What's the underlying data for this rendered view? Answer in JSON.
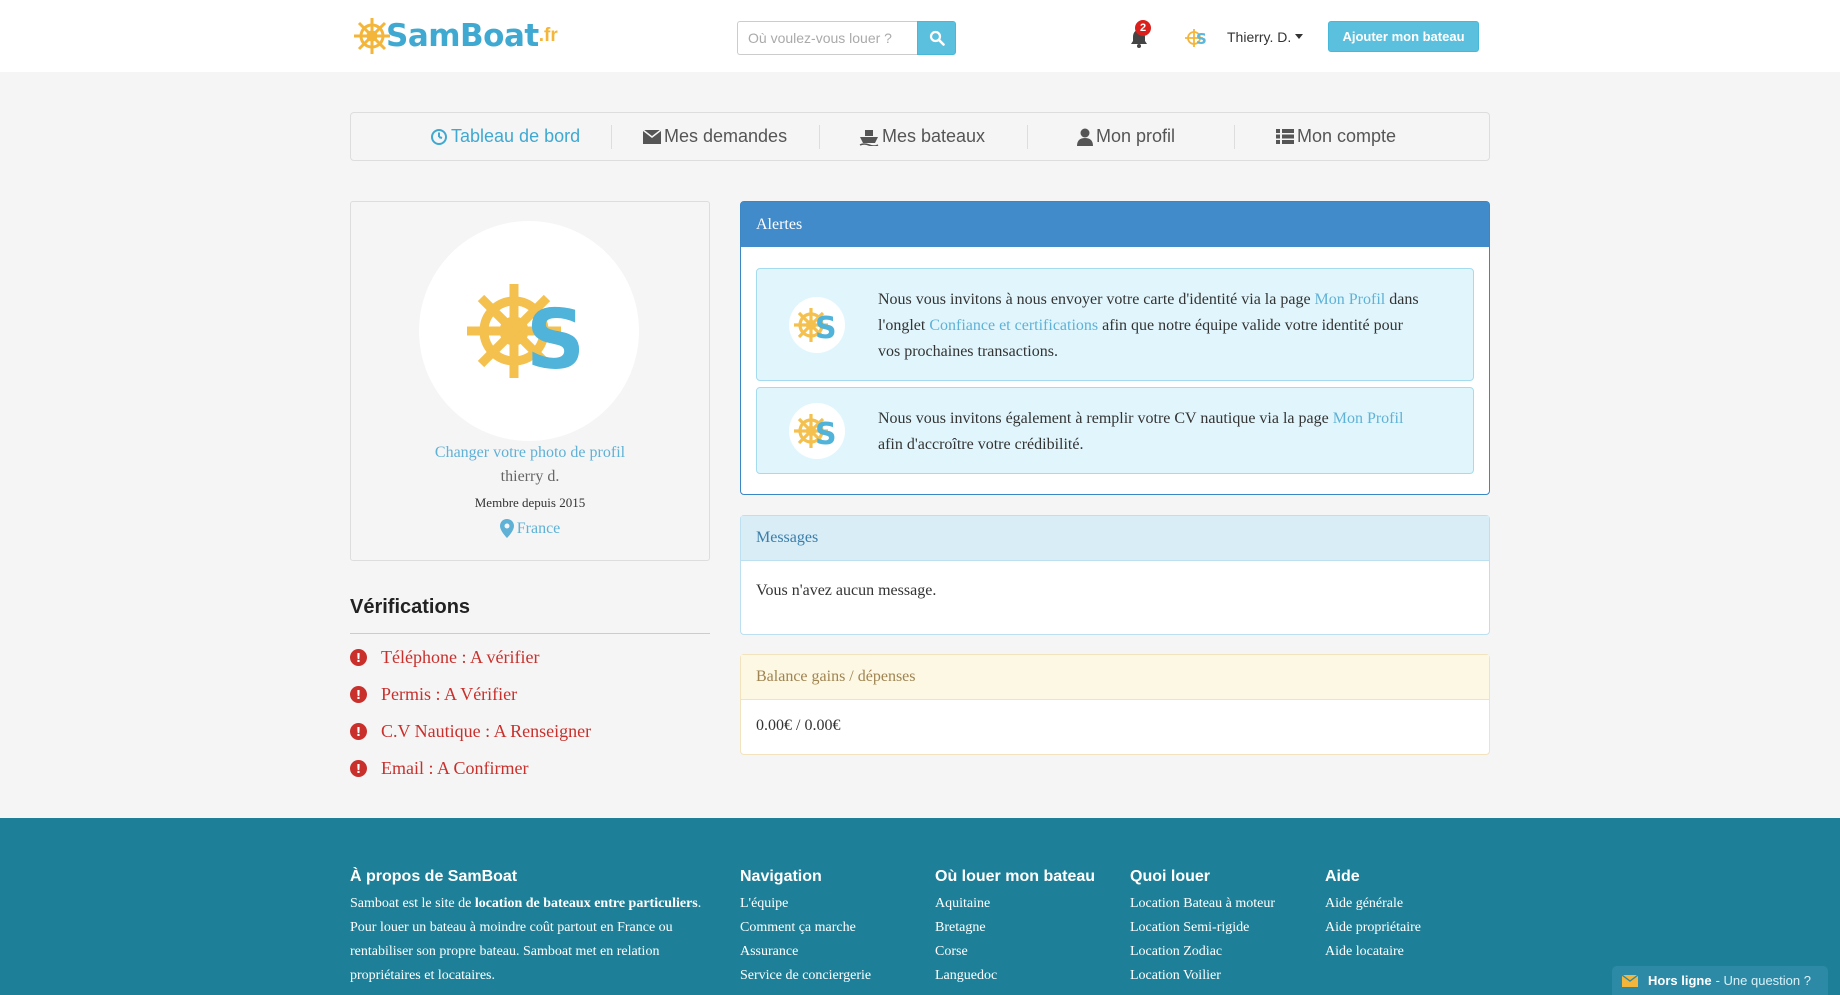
{
  "header": {
    "logo_text": "SamBoat",
    "logo_suffix": ".fr",
    "search_placeholder": "Où voulez-vous louer ?",
    "notification_count": "2",
    "user_name": "Thierry. D.",
    "add_boat_label": "Ajouter mon bateau"
  },
  "tabs": [
    {
      "label": "Tableau de bord",
      "active": true
    },
    {
      "label": "Mes demandes"
    },
    {
      "label": "Mes bateaux"
    },
    {
      "label": "Mon profil"
    },
    {
      "label": "Mon compte"
    }
  ],
  "profile": {
    "change_photo": "Changer votre photo de profil",
    "name": "thierry d.",
    "member_since": "Membre depuis 2015",
    "location": "France"
  },
  "verifications": {
    "title": "Vérifications",
    "items": [
      "Téléphone : A vérifier",
      "Permis : A Vérifier",
      "C.V Nautique : A Renseigner",
      "Email : A Confirmer"
    ]
  },
  "alerts": {
    "title": "Alertes",
    "a1_p1": "Nous vous invitons à nous envoyer votre carte d'identité via la page ",
    "a1_link1": "Mon Profil",
    "a1_p2": " dans l'onglet ",
    "a1_link2": "Confiance et certifications",
    "a1_p3": " afin que notre équipe valide votre identité pour vos prochaines transactions.",
    "a2_p1": "Nous vous invitons également à remplir votre CV nautique via la page ",
    "a2_link": "Mon Profil",
    "a2_p2": " afin d'accroître votre crédibilité."
  },
  "messages": {
    "title": "Messages",
    "empty_text": "Vous n'avez aucun message."
  },
  "balance": {
    "title": "Balance gains / dépenses",
    "value": "0.00€ / 0.00€"
  },
  "footer": {
    "about": {
      "title": "À propos de SamBoat",
      "t1": "Samboat est le site de ",
      "t_bold": "location de bateaux entre particuliers",
      "t2": ". Pour louer un bateau à moindre coût partout en France ou rentabiliser son propre bateau. Samboat met en relation propriétaires et locataires."
    },
    "navigation": {
      "title": "Navigation",
      "links": [
        "L'équipe",
        "Comment ça marche",
        "Assurance",
        "Service de conciergerie"
      ]
    },
    "where": {
      "title": "Où louer mon bateau",
      "links": [
        "Aquitaine",
        "Bretagne",
        "Corse",
        "Languedoc"
      ]
    },
    "what": {
      "title": "Quoi louer",
      "links": [
        "Location Bateau à moteur",
        "Location Semi-rigide",
        "Location Zodiac",
        "Location Voilier"
      ]
    },
    "help": {
      "title": "Aide",
      "links": [
        "Aide générale",
        "Aide propriétaire",
        "Aide locataire"
      ]
    }
  },
  "chat": {
    "status": "Hors ligne",
    "question": "- Une question ?"
  },
  "colors": {
    "brand_blue": "#3fa9d1",
    "brand_yellow": "#f4b63a",
    "primary": "#428bca",
    "danger": "#c9302c",
    "footer": "#1e8098"
  }
}
